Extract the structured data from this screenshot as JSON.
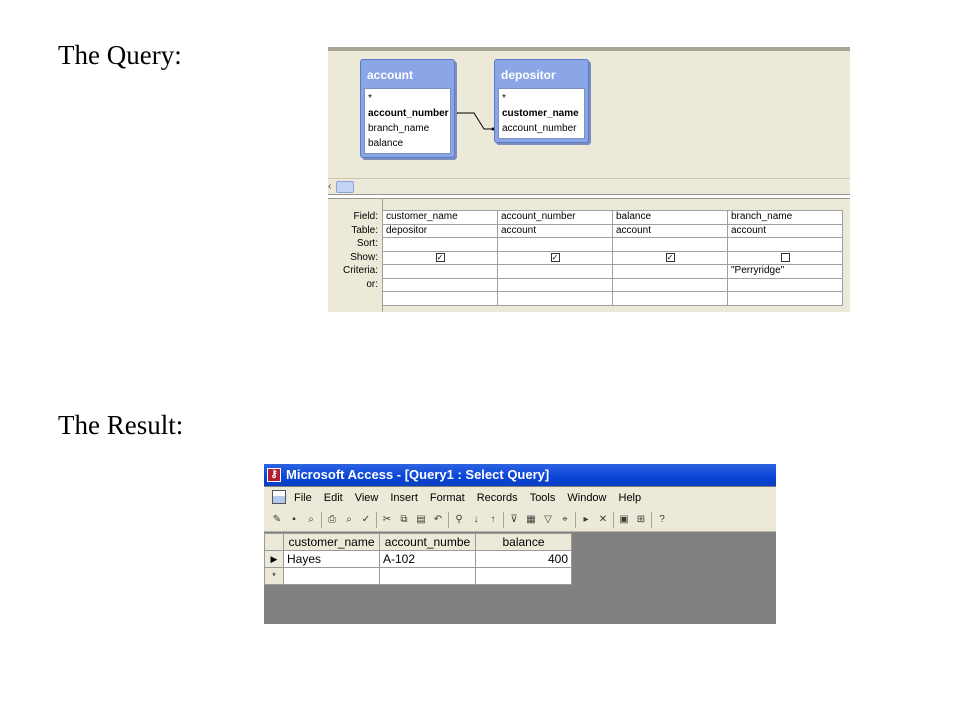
{
  "labels": {
    "query": "The Query:",
    "result": "The Result:"
  },
  "query_design": {
    "tables": [
      {
        "title": "account",
        "fields": [
          {
            "name": "*",
            "key": false
          },
          {
            "name": "account_number",
            "key": true
          },
          {
            "name": "branch_name",
            "key": false
          },
          {
            "name": "balance",
            "key": false
          }
        ]
      },
      {
        "title": "depositor",
        "fields": [
          {
            "name": "*",
            "key": false
          },
          {
            "name": "customer_name",
            "key": true
          },
          {
            "name": "account_number",
            "key": false
          }
        ]
      }
    ],
    "row_labels": [
      "Field:",
      "Table:",
      "Sort:",
      "Show:",
      "Criteria:",
      "or:"
    ],
    "columns": [
      {
        "field": "customer_name",
        "table": "depositor",
        "sort": "",
        "show": true,
        "criteria": "",
        "or": ""
      },
      {
        "field": "account_number",
        "table": "account",
        "sort": "",
        "show": true,
        "criteria": "",
        "or": ""
      },
      {
        "field": "balance",
        "table": "account",
        "sort": "",
        "show": true,
        "criteria": "",
        "or": ""
      },
      {
        "field": "branch_name",
        "table": "account",
        "sort": "",
        "show": false,
        "criteria": "\"Perryridge\"",
        "or": ""
      }
    ]
  },
  "access_window": {
    "title": "Microsoft Access - [Query1 : Select Query]",
    "menu": [
      "File",
      "Edit",
      "View",
      "Insert",
      "Format",
      "Records",
      "Tools",
      "Window",
      "Help"
    ],
    "datasheet": {
      "headers": [
        "customer_name",
        "account_numbe",
        "balance"
      ],
      "rows": [
        [
          "Hayes",
          "A-102",
          "400"
        ]
      ],
      "new_row_marker": "*",
      "current_row_marker": "▶"
    }
  }
}
